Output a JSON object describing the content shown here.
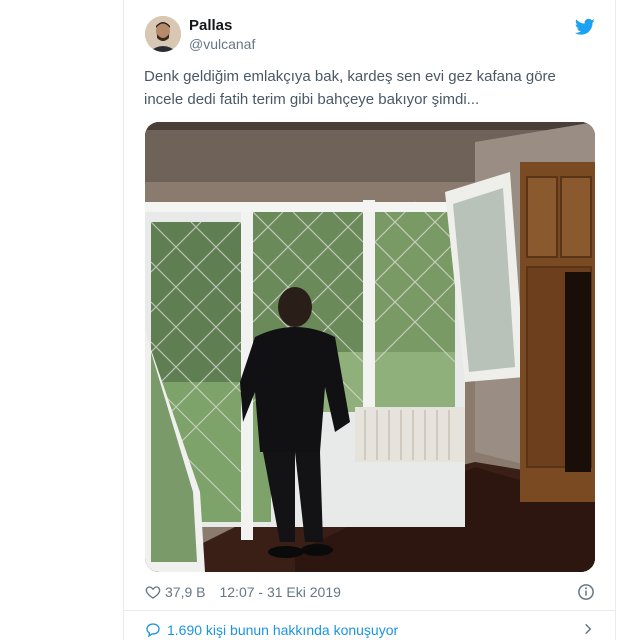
{
  "tweet": {
    "author_name": "Pallas",
    "author_handle": "@vulcanaf",
    "text_line1": "Denk geldiğim emlakçıya bak, kardeş sen evi gez kafana göre",
    "text_line2": "incele dedi fatih terim gibi bahçeye bakıyor şimdi...",
    "likes": "37,9 B",
    "timestamp": "12:07 - 31 Eki 2019",
    "conversation": "1.690 kişi bunun hakkında konuşuyor"
  },
  "icons": {
    "brand": "twitter-bird-icon",
    "like": "heart-icon",
    "info": "info-icon",
    "reply": "speech-bubble-icon",
    "expand": "chevron-right-icon"
  },
  "colors": {
    "brand_blue": "#1da1f2",
    "link_blue": "#1b95e0",
    "muted": "#657786"
  }
}
